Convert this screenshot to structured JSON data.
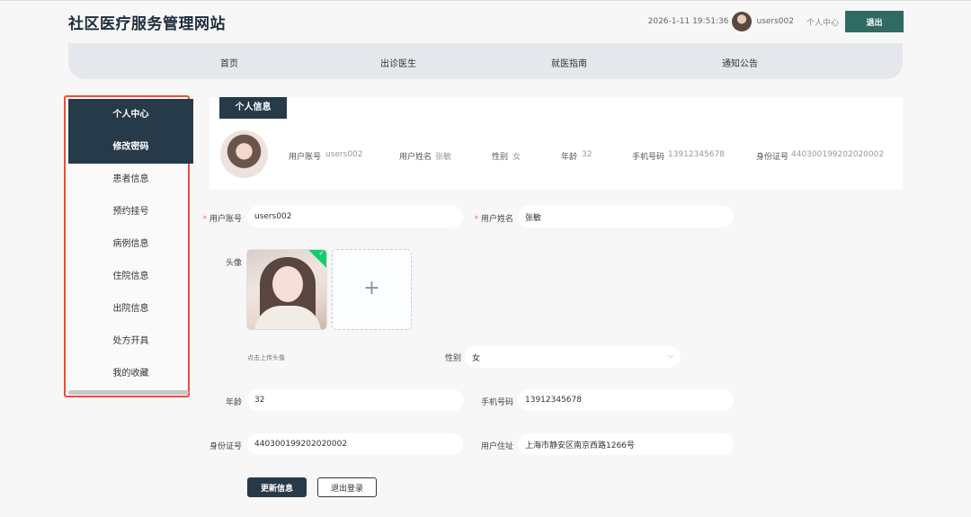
{
  "header": {
    "title": "社区医疗服务管理网站",
    "datetime": "2026-1-11 19:51:36",
    "username": "users002",
    "center_link": "个人中心",
    "logout_label": "退出"
  },
  "nav": {
    "items": [
      "首页",
      "出诊医生",
      "就医指南",
      "通知公告"
    ]
  },
  "sidebar": {
    "items": [
      "个人中心",
      "修改密码",
      "患者信息",
      "预约挂号",
      "病例信息",
      "住院信息",
      "出院信息",
      "处方开具",
      "我的收藏"
    ]
  },
  "info_card": {
    "tab_label": "个人信息",
    "fields": [
      {
        "label": "用户账号",
        "value": "users002"
      },
      {
        "label": "用户姓名",
        "value": "张敏"
      },
      {
        "label": "性别",
        "value": "女"
      },
      {
        "label": "年龄",
        "value": "32"
      },
      {
        "label": "手机号码",
        "value": "13912345678"
      },
      {
        "label": "身份证号",
        "value": "440300199202020002"
      }
    ]
  },
  "form": {
    "account_label": "用户账号",
    "account_value": "users002",
    "name_label": "用户姓名",
    "name_value": "张敏",
    "required_mark": "*",
    "avatar_label": "头像",
    "upload_hint": "点击上传头像",
    "upload_plus": "+",
    "gender_label": "性别",
    "gender_value": "女",
    "age_label": "年龄",
    "age_value": "32",
    "phone_label": "手机号码",
    "phone_value": "13912345678",
    "id_label": "身份证号",
    "id_value": "440300199202020002",
    "address_label": "用户住址",
    "address_value": "上海市静安区南京西路1266号",
    "update_label": "更新信息",
    "logout_label": "退出登录"
  },
  "colors": {
    "primary": "#273a4a",
    "accent": "#2f6b63",
    "highlight_border": "#ef4b3a",
    "success": "#13ce66"
  }
}
